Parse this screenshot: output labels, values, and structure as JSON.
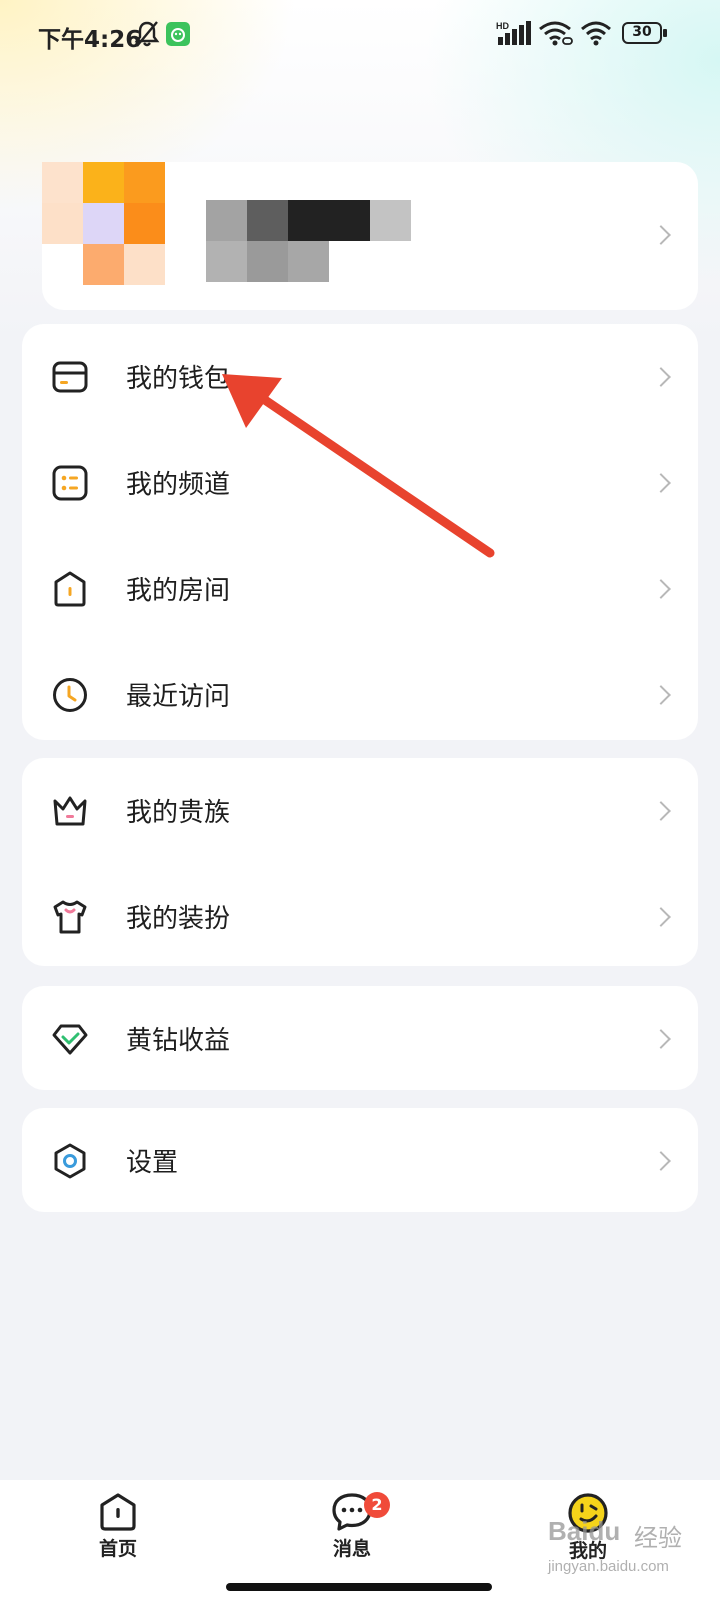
{
  "status_bar": {
    "time": "下午4:26",
    "network_label": "HD",
    "battery": "30",
    "icons": [
      "mute-bell-icon",
      "app-notification-icon",
      "signal-icon",
      "wifi-linked-icon",
      "wifi-icon",
      "battery-icon"
    ]
  },
  "profile": {
    "avatar_icon": "pixelated-avatar",
    "name_icon": "pixelated-name"
  },
  "menu_groups": [
    {
      "items": [
        {
          "label": "我的钱包",
          "icon": "wallet-icon"
        },
        {
          "label": "我的频道",
          "icon": "channel-icon"
        },
        {
          "label": "我的房间",
          "icon": "room-icon"
        },
        {
          "label": "最近访问",
          "icon": "clock-icon"
        }
      ]
    },
    {
      "items": [
        {
          "label": "我的贵族",
          "icon": "crown-icon"
        },
        {
          "label": "我的装扮",
          "icon": "tshirt-icon"
        }
      ]
    },
    {
      "items": [
        {
          "label": "黄钻收益",
          "icon": "diamond-icon"
        }
      ]
    },
    {
      "items": [
        {
          "label": "设置",
          "icon": "settings-icon"
        }
      ]
    }
  ],
  "bottom_nav": {
    "home": {
      "label": "首页",
      "icon": "home-icon"
    },
    "messages": {
      "label": "消息",
      "icon": "chat-icon",
      "badge": "2"
    },
    "me": {
      "label": "我的",
      "icon": "face-icon"
    }
  },
  "watermark": {
    "brand": "Baidu",
    "brand_cn": "经验",
    "url": "jingyan.baidu.com"
  },
  "colors": {
    "accent_yellow": "#f5c518",
    "accent_green": "#2fbf71",
    "annotation_red": "#e8432e",
    "badge_red": "#f04b3a",
    "background": "#f2f3f7"
  }
}
